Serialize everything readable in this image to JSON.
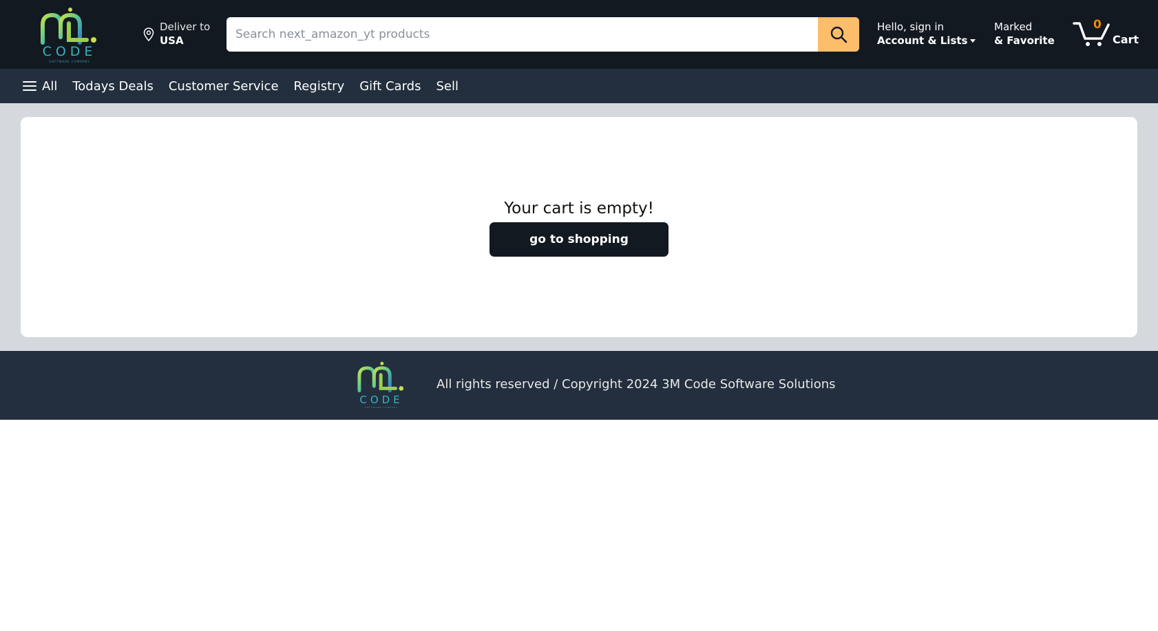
{
  "brand": {
    "logo_text": "CODE",
    "logo_subtext": "SOFTWARE COMPANY",
    "colors": {
      "logo_green": "#9bd14a",
      "logo_blue": "#2fb6c0"
    }
  },
  "header": {
    "deliver_label": "Deliver to",
    "deliver_location": "USA",
    "search_placeholder": "Search next_amazon_yt products",
    "account_greeting": "Hello, sign in",
    "account_label": "Account & Lists",
    "favorite_line1": "Marked",
    "favorite_line2": "& Favorite",
    "cart_count": "0",
    "cart_label": "Cart",
    "icons": {
      "location": "location-pin-icon",
      "search": "search-icon",
      "cart": "cart-icon",
      "menu": "hamburger-menu-icon",
      "caret": "caret-down-icon"
    },
    "colors": {
      "header_bg": "#131921",
      "nav_bg": "#232f3e",
      "search_button": "#febd69",
      "cart_count": "#f08804"
    }
  },
  "nav": {
    "items": [
      "All",
      "Todays Deals",
      "Customer Service",
      "Registry",
      "Gift Cards",
      "Sell"
    ]
  },
  "cart_page": {
    "empty_message": "Your cart is empty!",
    "button_label": "go to shopping"
  },
  "footer": {
    "copyright": "All rights reserved / Copyright 2024 3M Code Software Solutions"
  }
}
